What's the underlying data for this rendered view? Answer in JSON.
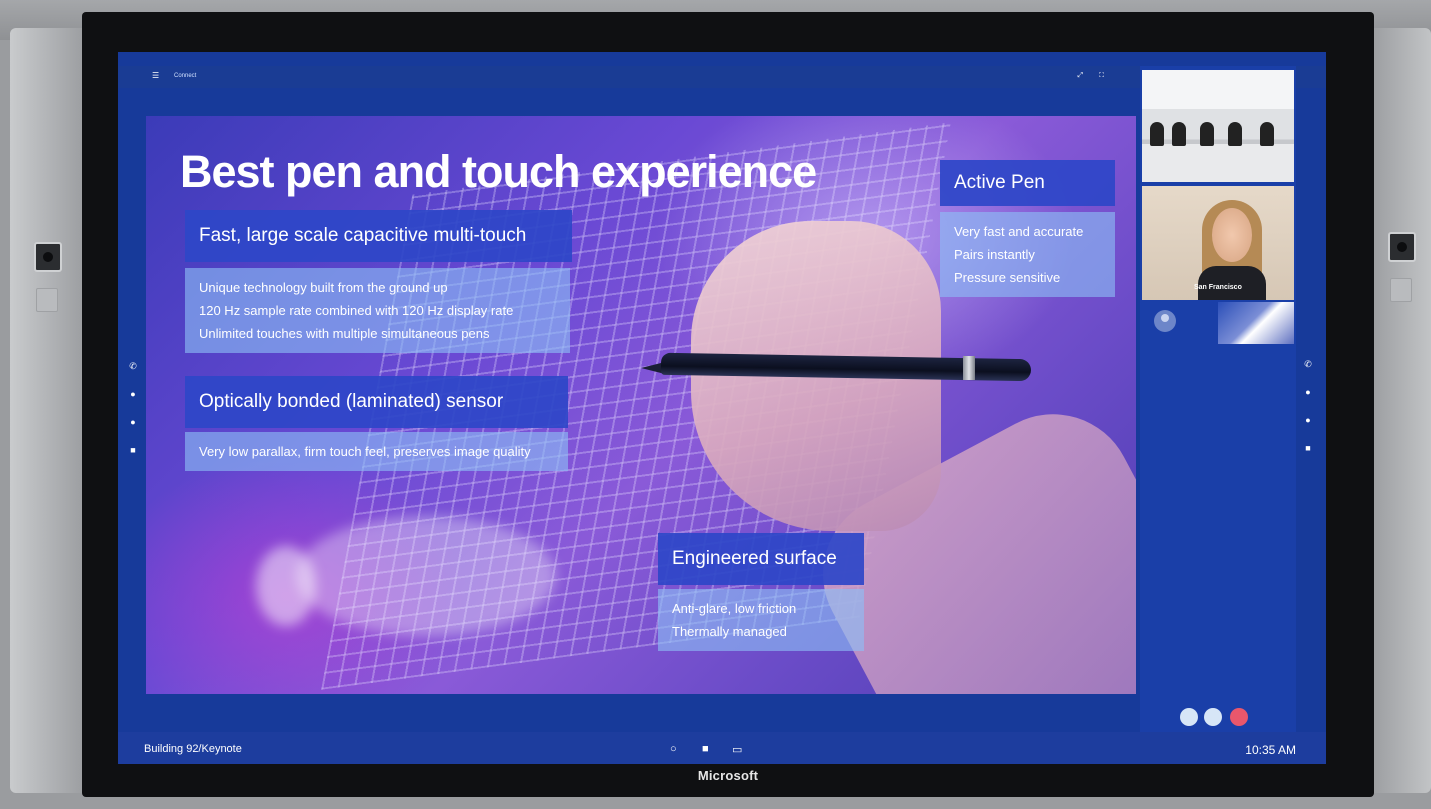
{
  "device": {
    "brand": "Microsoft"
  },
  "app": {
    "name": "Connect"
  },
  "slide": {
    "title": "Best pen and touch experience",
    "boxes": [
      {
        "heading": "Fast, large scale capacitive multi-touch",
        "lines": [
          "Unique technology built from the ground up",
          "120 Hz sample rate combined with 120 Hz display rate",
          "Unlimited touches with multiple simultaneous pens"
        ]
      },
      {
        "heading": "Optically bonded (laminated) sensor",
        "lines": [
          "Very low parallax, firm touch feel, preserves image quality"
        ]
      },
      {
        "heading": "Active Pen",
        "lines": [
          "Very fast and accurate",
          "Pairs instantly",
          "Pressure sensitive"
        ]
      },
      {
        "heading": "Engineered surface",
        "lines": [
          "Anti-glare, low friction",
          "Thermally managed"
        ]
      }
    ]
  },
  "call_panel": {
    "caller_name": "San Francisco",
    "buttons": [
      {
        "name": "mute",
        "color": "#d7e6f7"
      },
      {
        "name": "video",
        "color": "#d7e6f7"
      },
      {
        "name": "hang-up",
        "color": "#e9576c"
      }
    ]
  },
  "taskbar": {
    "location": "Building 92/Keynote",
    "time": "10:35 AM",
    "icons": [
      "search-icon",
      "windows-icon",
      "task-view-icon"
    ]
  },
  "colors": {
    "accent": "#1d3d9e",
    "box_heading": "#2e46c8",
    "hangup": "#e9576c"
  }
}
